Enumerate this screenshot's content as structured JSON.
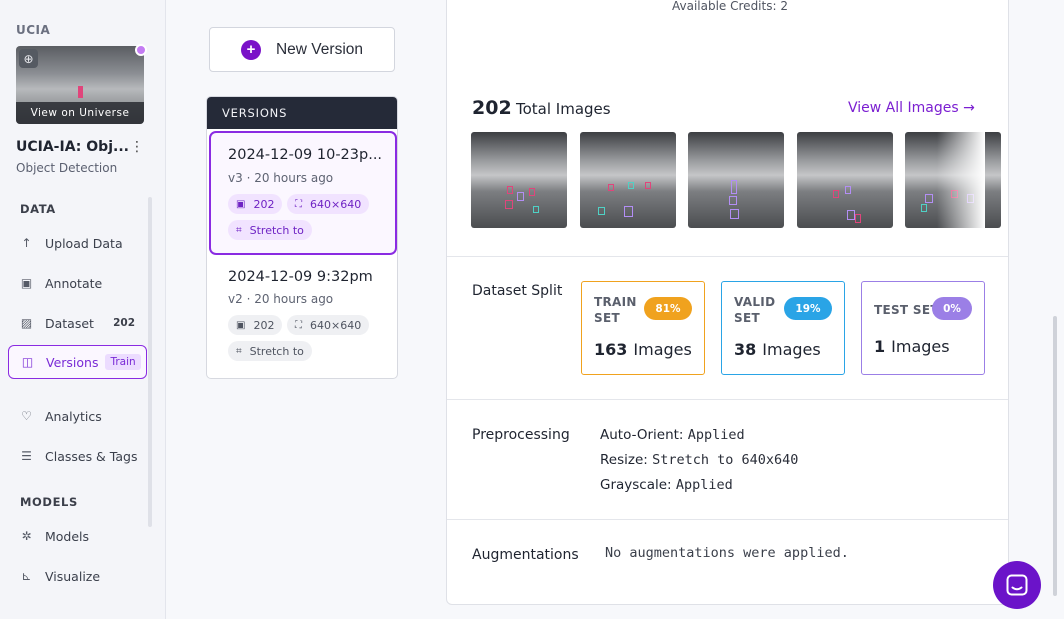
{
  "sidebar": {
    "workspace": "UCIA",
    "thumbnail_button": "View on Universe",
    "project_name": "UCIA-IA: Obj...",
    "project_type": "Object Detection",
    "sections": [
      {
        "title": "DATA",
        "items": [
          {
            "label": "Upload Data",
            "icon": "upload-icon"
          },
          {
            "label": "Annotate",
            "icon": "annotate-icon"
          },
          {
            "label": "Dataset",
            "icon": "dataset-icon",
            "count": "202"
          },
          {
            "label": "Versions",
            "icon": "versions-icon",
            "badge": "Train",
            "active": true
          },
          {
            "label": "Analytics",
            "icon": "analytics-icon"
          },
          {
            "label": "Classes & Tags",
            "icon": "classes-icon"
          }
        ]
      },
      {
        "title": "MODELS",
        "items": [
          {
            "label": "Models",
            "icon": "models-icon"
          },
          {
            "label": "Visualize",
            "icon": "visualize-icon"
          }
        ]
      }
    ]
  },
  "middle": {
    "new_version_label": "New Version",
    "versions_header": "VERSIONS",
    "versions": [
      {
        "title": "2024-12-09 10-23p...",
        "version": "v3",
        "age": "20 hours ago",
        "images": "202",
        "size": "640×640",
        "resize": "Stretch to",
        "active": true
      },
      {
        "title": "2024-12-09 9:32pm",
        "version": "v2",
        "age": "20 hours ago",
        "images": "202",
        "size": "640×640",
        "resize": "Stretch to",
        "active": false
      }
    ]
  },
  "main": {
    "credits": "Available Credits:  2",
    "total_images_count": "202",
    "total_images_label": "Total Images",
    "view_all_label": "View All Images →",
    "dataset_split_label": "Dataset Split",
    "split": [
      {
        "name_line1": "TRAIN",
        "name_line2": "SET",
        "pct": "81%",
        "count": "163",
        "unit": "Images",
        "color": "#f0a21e"
      },
      {
        "name_line1": "VALID",
        "name_line2": "SET",
        "pct": "19%",
        "count": "38",
        "unit": "Images",
        "color": "#2aa4e6"
      },
      {
        "name_line1": "TEST SET",
        "name_line2": "",
        "pct": "0%",
        "count": "1",
        "unit": "Images",
        "color": "#9b7fe6"
      }
    ],
    "preprocessing_label": "Preprocessing",
    "preprocessing": [
      {
        "key": "Auto-Orient:",
        "value": "Applied"
      },
      {
        "key": "Resize:",
        "value": "Stretch to 640x640"
      },
      {
        "key": "Grayscale:",
        "value": "Applied"
      }
    ],
    "augmentations_label": "Augmentations",
    "augmentations_value": "No augmentations were applied."
  },
  "colors": {
    "accent": "#7a11c8",
    "sidebar_bg": "#f4f5f9",
    "header_dark": "#252a38"
  }
}
